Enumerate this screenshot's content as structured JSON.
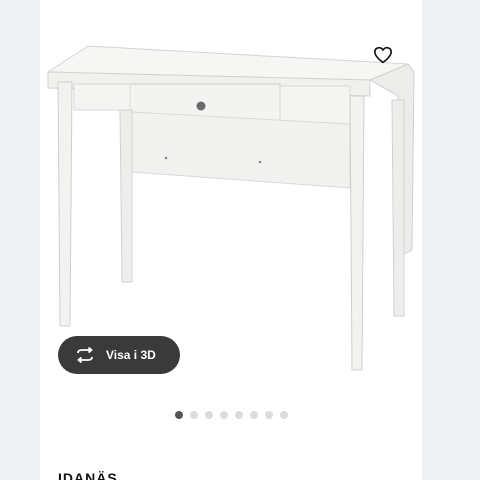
{
  "product": {
    "name": "IDANÄS",
    "image_alt": "white drop-leaf desk with one drawer"
  },
  "buttons": {
    "view_3d": "Visa i 3D"
  },
  "icons": {
    "favorite": "heart-icon",
    "view_3d": "rotate-3d-icon"
  },
  "carousel": {
    "total": 8,
    "active_index": 0
  },
  "colors": {
    "button_bg": "#3a3a3a",
    "dot_active": "#555555",
    "dot_inactive": "#dcdcdc",
    "background": "#eef0f2"
  }
}
